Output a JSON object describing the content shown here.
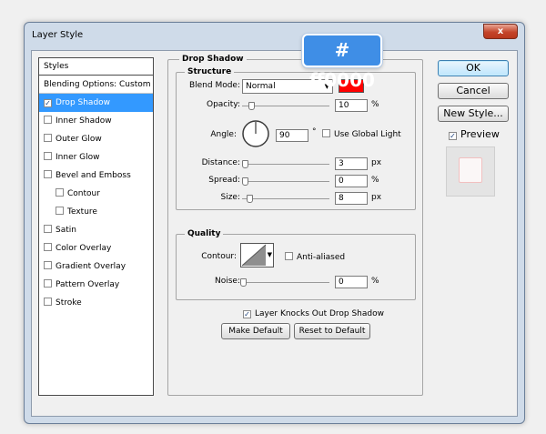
{
  "window": {
    "title": "Layer Style",
    "close_label": "x"
  },
  "styles_list": {
    "header": "Styles",
    "blending_options": "Blending Options: Custom",
    "items": [
      {
        "label": "Drop Shadow",
        "checked": true,
        "active": true,
        "sub": false
      },
      {
        "label": "Inner Shadow",
        "checked": false,
        "active": false,
        "sub": false
      },
      {
        "label": "Outer Glow",
        "checked": false,
        "active": false,
        "sub": false
      },
      {
        "label": "Inner Glow",
        "checked": false,
        "active": false,
        "sub": false
      },
      {
        "label": "Bevel and Emboss",
        "checked": false,
        "active": false,
        "sub": false
      },
      {
        "label": "Contour",
        "checked": false,
        "active": false,
        "sub": true
      },
      {
        "label": "Texture",
        "checked": false,
        "active": false,
        "sub": true
      },
      {
        "label": "Satin",
        "checked": false,
        "active": false,
        "sub": false
      },
      {
        "label": "Color Overlay",
        "checked": false,
        "active": false,
        "sub": false
      },
      {
        "label": "Gradient Overlay",
        "checked": false,
        "active": false,
        "sub": false
      },
      {
        "label": "Pattern Overlay",
        "checked": false,
        "active": false,
        "sub": false
      },
      {
        "label": "Stroke",
        "checked": false,
        "active": false,
        "sub": false
      }
    ]
  },
  "drop_shadow": {
    "title": "Drop Shadow",
    "structure": {
      "title": "Structure",
      "blend_mode_label": "Blend Mode:",
      "blend_mode_value": "Normal",
      "shadow_color": "#ff0000",
      "opacity_label": "Opacity:",
      "opacity_value": "10",
      "opacity_unit": "%",
      "opacity_level": 0.1,
      "angle_label": "Angle:",
      "angle_value": "90",
      "angle_unit": "°",
      "use_global_light_label": "Use Global Light",
      "use_global_light_checked": false,
      "distance_label": "Distance:",
      "distance_value": "3",
      "distance_unit": "px",
      "spread_label": "Spread:",
      "spread_value": "0",
      "spread_unit": "%",
      "size_label": "Size:",
      "size_value": "8",
      "size_unit": "px"
    },
    "quality": {
      "title": "Quality",
      "contour_label": "Contour:",
      "anti_aliased_label": "Anti-aliased",
      "anti_aliased_checked": false,
      "noise_label": "Noise:",
      "noise_value": "0",
      "noise_unit": "%"
    },
    "knocks_out_label": "Layer Knocks Out Drop Shadow",
    "knocks_out_checked": true,
    "make_default_label": "Make Default",
    "reset_default_label": "Reset to Default"
  },
  "buttons": {
    "ok": "OK",
    "cancel": "Cancel",
    "new_style": "New Style...",
    "preview_label": "Preview",
    "preview_checked": true
  },
  "callout": {
    "text": "# ff0000",
    "color": "#3f8ee6"
  },
  "icons": {
    "check": "✓",
    "dropdown_arrow": "▼"
  }
}
